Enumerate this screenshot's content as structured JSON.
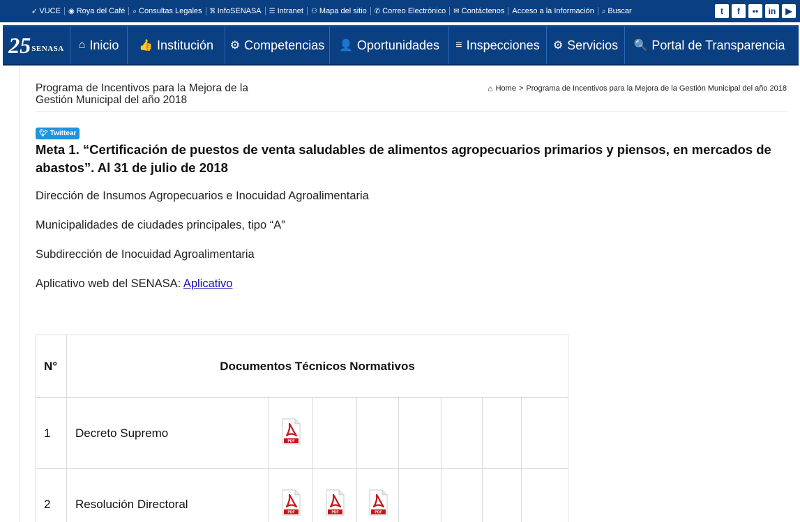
{
  "topbar": {
    "items": [
      {
        "icon": "arrow-icon",
        "glyph": "➶",
        "label": "VUCE"
      },
      {
        "icon": "globe-icon",
        "glyph": "◉",
        "label": "Roya del Café"
      },
      {
        "icon": "search-icon",
        "glyph": "⌕",
        "label": "Consultas Legales"
      },
      {
        "icon": "rss-icon",
        "glyph": "ℜ",
        "label": "InfoSENASA"
      },
      {
        "icon": "intranet-icon",
        "glyph": "☰",
        "label": "Intranet"
      },
      {
        "icon": "sitemap-icon",
        "glyph": "⚇",
        "label": "Mapa del sitio"
      },
      {
        "icon": "email-icon",
        "glyph": "✆",
        "label": "Correo Electrónico"
      },
      {
        "icon": "envelope-icon",
        "glyph": "✉",
        "label": "Contáctenos"
      },
      {
        "icon": "",
        "glyph": "",
        "label": "Acceso a la Información"
      },
      {
        "icon": "search-icon",
        "glyph": "⌕",
        "label": "Buscar"
      }
    ],
    "social": [
      {
        "icon": "twitter-icon",
        "glyph": "t"
      },
      {
        "icon": "facebook-icon",
        "glyph": "f"
      },
      {
        "icon": "flickr-icon",
        "glyph": "••"
      },
      {
        "icon": "linkedin-icon",
        "glyph": "in"
      },
      {
        "icon": "youtube-icon",
        "glyph": "▶"
      }
    ]
  },
  "logo": {
    "number": "25",
    "text": "SENASA"
  },
  "nav": [
    {
      "icon": "home-icon",
      "glyph": "⌂",
      "label": "Inicio"
    },
    {
      "icon": "thumbs-up-icon",
      "glyph": "👍",
      "label": "Institución"
    },
    {
      "icon": "gear-icon",
      "glyph": "⚙",
      "label": "Competencias"
    },
    {
      "icon": "add-user-icon",
      "glyph": "👤",
      "label": "Oportunidades"
    },
    {
      "icon": "menu-icon",
      "glyph": "≡",
      "label": "Inspecciones"
    },
    {
      "icon": "gears-icon",
      "glyph": "⚙",
      "label": "Servicios"
    },
    {
      "icon": "search-icon",
      "glyph": "🔍",
      "label": "Portal de Transparencia"
    }
  ],
  "page": {
    "title": "Programa de Incentivos para la Mejora de la Gestión Municipal del año 2018",
    "breadcrumb": {
      "home": "Home",
      "sep": ">",
      "current": "Programa de Incentivos para la Mejora de la Gestión Municipal del año 2018"
    },
    "tweet_label": "Twittear",
    "meta_title": "Meta 1. “Certificación de puestos de venta saludables de alimentos agropecuarios primarios y piensos, en mercados de abastos”. Al 31 de julio de 2018",
    "lines": [
      "Dirección de Insumos Agropecuarios e Inocuidad Agroalimentaria",
      "Municipalidades de ciudades principales, tipo “A”",
      "Subdirección de Inocuidad Agroalimentaria"
    ],
    "app_line": {
      "text": "Aplicativo web del SENASA: ",
      "link": "Aplicativo"
    }
  },
  "table": {
    "headers": {
      "num": "N°",
      "title": "Documentos Técnicos Normativos"
    },
    "rows": [
      {
        "num": "1",
        "name": "Decreto Supremo",
        "pdfs": 1
      },
      {
        "num": "2",
        "name": "Resolución Directoral",
        "pdfs": 3
      }
    ],
    "pdf_label": "PDF"
  }
}
